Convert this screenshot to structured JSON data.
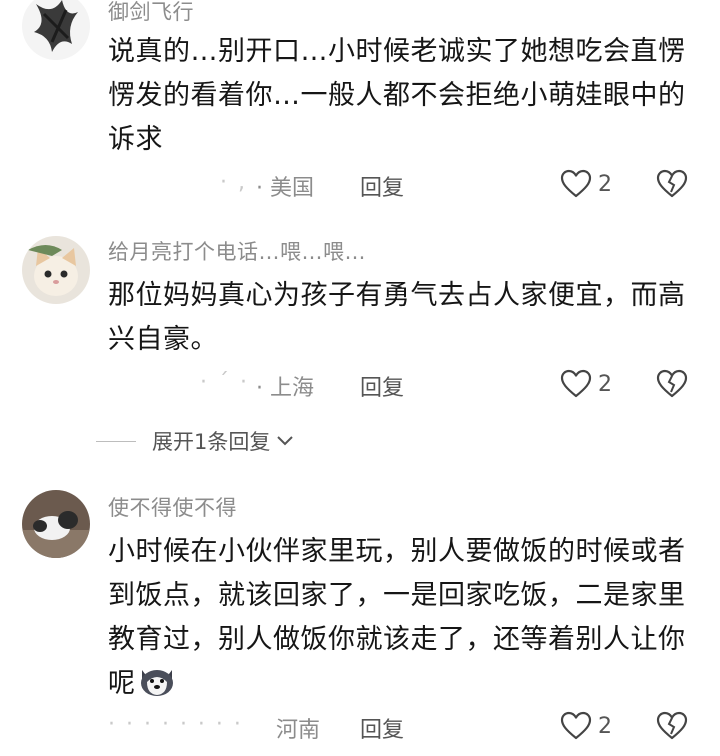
{
  "comments": [
    {
      "username": "御剑飞行",
      "text": "说真的…别开口…小时候老诚实了她想吃会直愣愣发的看着你…一般人都不会拒绝小萌娃眼中的诉求",
      "time": "· ,",
      "location": "· 美国",
      "reply": "回复",
      "likes": "2"
    },
    {
      "username": "给月亮打个电话…喂…喂…",
      "text": "那位妈妈真心为孩子有勇气去占人家便宜，而高兴自豪。",
      "time": "· ˊ ·",
      "location": "· 上海",
      "reply": "回复",
      "likes": "2"
    },
    {
      "username": "使不得使不得",
      "text": "小时候在小伙伴家里玩，别人要做饭的时候或者到饭点，就该回家了，一是回家吃饭，二是家里教育过，别人做饭你就该走了，还等着别人让你呢",
      "time": "· · · · · · · ·",
      "location": "河南",
      "reply": "回复",
      "likes": "2"
    }
  ],
  "expand_label": "展开1条回复",
  "icons": {
    "like": "heart-outline-icon",
    "dislike": "broken-heart-outline-icon",
    "expand": "chevron-down-icon",
    "emoji": "husky-dog-emoji-icon"
  },
  "colors": {
    "text": "#161616",
    "secondary": "#8c8c8c",
    "action": "#555555"
  }
}
